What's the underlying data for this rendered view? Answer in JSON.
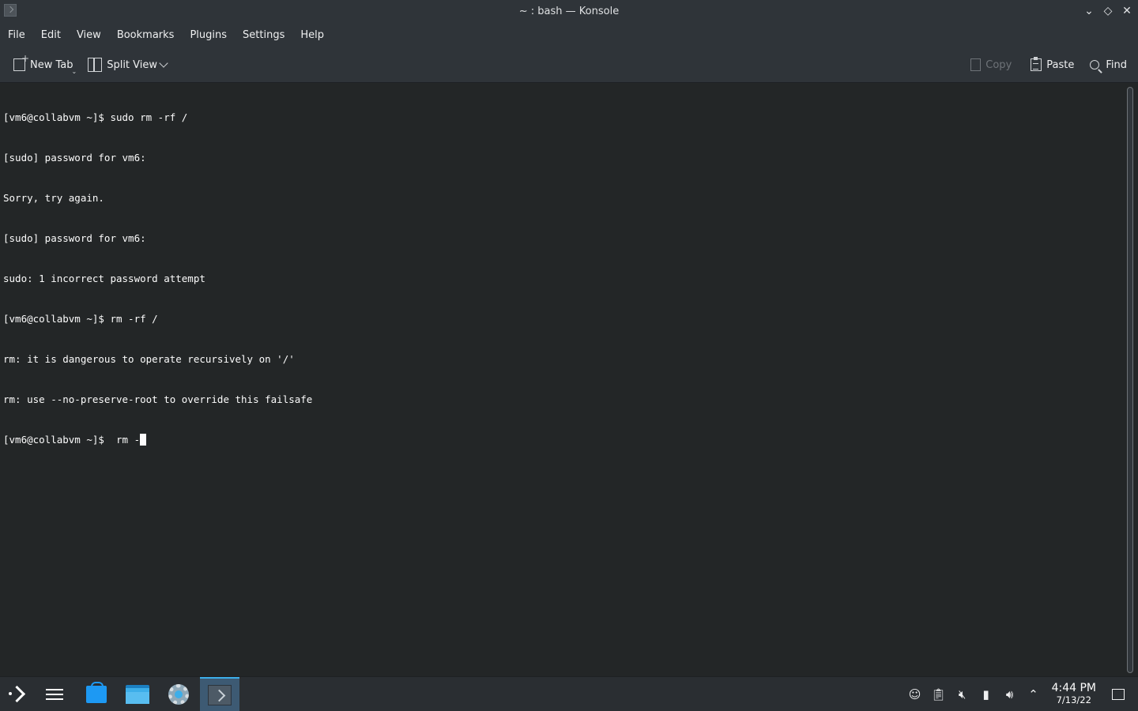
{
  "window": {
    "title": "~ : bash — Konsole",
    "controls": [
      "minimize",
      "maximize",
      "close"
    ]
  },
  "menubar": {
    "items": [
      "File",
      "Edit",
      "View",
      "Bookmarks",
      "Plugins",
      "Settings",
      "Help"
    ]
  },
  "toolbar": {
    "new_tab_label": "New Tab",
    "split_view_label": "Split View",
    "copy_label": "Copy",
    "paste_label": "Paste",
    "find_label": "Find"
  },
  "terminal": {
    "lines": [
      "[vm6@collabvm ~]$ sudo rm -rf /",
      "[sudo] password for vm6:",
      "Sorry, try again.",
      "[sudo] password for vm6:",
      "sudo: 1 incorrect password attempt",
      "[vm6@collabvm ~]$ rm -rf /",
      "rm: it is dangerous to operate recursively on '/'",
      "rm: use --no-preserve-root to override this failsafe"
    ],
    "current_prompt": "[vm6@collabvm ~]$  rm -"
  },
  "taskbar": {
    "apps": [
      "application-launcher-icon",
      "system-settings-icon",
      "discover-icon",
      "file-manager-icon",
      "settings-gear-icon",
      "konsole-icon"
    ],
    "tray_icons": [
      "user-switch-icon",
      "clipboard-icon",
      "audio-muted-icon",
      "removable-device-icon",
      "volume-icon",
      "expand-tray-icon"
    ],
    "clock": {
      "time": "4:44 PM",
      "date": "7/13/22"
    }
  },
  "colors": {
    "terminal_bg": "#232627",
    "terminal_fg": "#fcfcfc",
    "chrome_bg": "#2f3439",
    "accent": "#3daee9"
  }
}
